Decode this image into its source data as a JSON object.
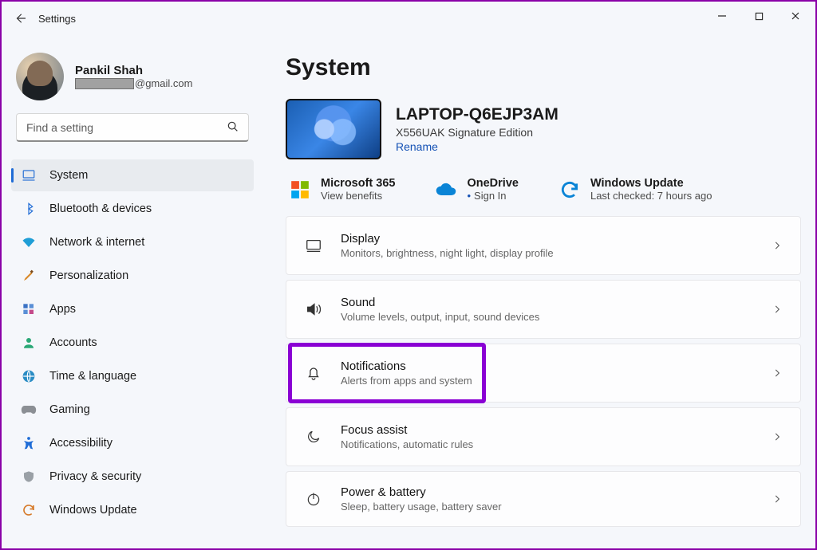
{
  "titlebar": {
    "app_title": "Settings"
  },
  "user": {
    "name": "Pankil Shah",
    "email_suffix": "@gmail.com"
  },
  "search": {
    "placeholder": "Find a setting"
  },
  "nav": [
    {
      "label": "System",
      "icon": "system"
    },
    {
      "label": "Bluetooth & devices",
      "icon": "bluetooth"
    },
    {
      "label": "Network & internet",
      "icon": "wifi"
    },
    {
      "label": "Personalization",
      "icon": "brush"
    },
    {
      "label": "Apps",
      "icon": "apps"
    },
    {
      "label": "Accounts",
      "icon": "person"
    },
    {
      "label": "Time & language",
      "icon": "globe"
    },
    {
      "label": "Gaming",
      "icon": "gamepad"
    },
    {
      "label": "Accessibility",
      "icon": "access"
    },
    {
      "label": "Privacy & security",
      "icon": "shield"
    },
    {
      "label": "Windows Update",
      "icon": "update"
    }
  ],
  "page": {
    "title": "System"
  },
  "device": {
    "name": "LAPTOP-Q6EJP3AM",
    "model": "X556UAK Signature Edition",
    "rename": "Rename"
  },
  "services": {
    "m365": {
      "title": "Microsoft 365",
      "sub": "View benefits"
    },
    "onedrive": {
      "title": "OneDrive",
      "sub": "Sign In"
    },
    "update": {
      "title": "Windows Update",
      "sub": "Last checked: 7 hours ago"
    }
  },
  "settings": [
    {
      "title": "Display",
      "sub": "Monitors, brightness, night light, display profile",
      "icon": "display"
    },
    {
      "title": "Sound",
      "sub": "Volume levels, output, input, sound devices",
      "icon": "sound"
    },
    {
      "title": "Notifications",
      "sub": "Alerts from apps and system",
      "icon": "bell",
      "highlighted": true
    },
    {
      "title": "Focus assist",
      "sub": "Notifications, automatic rules",
      "icon": "moon"
    },
    {
      "title": "Power & battery",
      "sub": "Sleep, battery usage, battery saver",
      "icon": "power"
    }
  ]
}
